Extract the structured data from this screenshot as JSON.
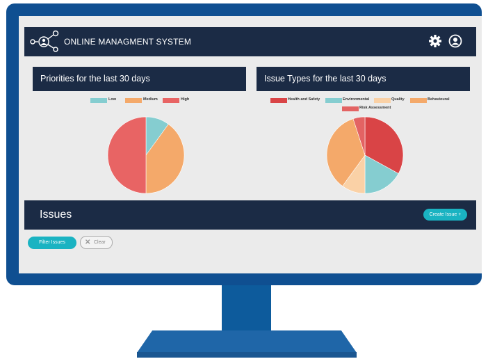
{
  "header": {
    "title": "ONLINE MANAGMENT SYSTEM",
    "icons": [
      "network-logo-icon",
      "gear-icon",
      "user-icon"
    ]
  },
  "panels": {
    "left_title": "Priorities for the last 30 days",
    "right_title": "Issue Types for the last 30 days"
  },
  "issues": {
    "title": "Issues",
    "create_label": "Create Issue +"
  },
  "filters": {
    "filter_label": "Filter Issues",
    "clear_label": "Clear"
  },
  "colors": {
    "frame": "#0f4f91",
    "bar": "#1b2b45",
    "accent": "#1ab3c2"
  },
  "chart_data": [
    {
      "type": "pie",
      "title": "Priorities for the last 30 days",
      "labels": [
        "Low",
        "Medium",
        "High"
      ],
      "values": [
        10,
        40,
        50
      ],
      "colors": [
        "#85cdd0",
        "#f4a96a",
        "#e86464"
      ],
      "legend": "top"
    },
    {
      "type": "pie",
      "title": "Issue Types for the last 30 days",
      "labels": [
        "Health and Safety",
        "Environmental",
        "Quality",
        "Behavioural",
        "Risk Assessment"
      ],
      "values": [
        33,
        17,
        10,
        35,
        5
      ],
      "colors": [
        "#d94446",
        "#85cdd0",
        "#fad1a6",
        "#f4a96a",
        "#e36363"
      ],
      "legend": "top"
    }
  ]
}
